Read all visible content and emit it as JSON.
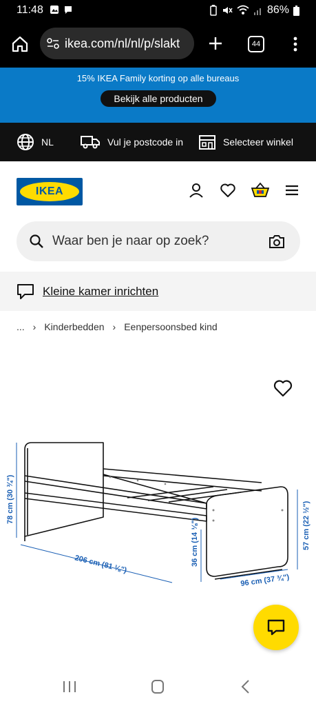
{
  "status": {
    "time": "11:48",
    "battery": "86%"
  },
  "browser": {
    "url": "ikea.com/nl/nl/p/slakt",
    "tab_count": "44"
  },
  "promo": {
    "text": "15% IKEA Family korting op alle bureaus",
    "button": "Bekijk alle producten"
  },
  "utility": {
    "language": "NL",
    "postcode": "Vul je postcode in",
    "store": "Selecteer winkel"
  },
  "header": {
    "logo_text": "IKEA"
  },
  "search": {
    "placeholder": "Waar ben je naar op zoek?"
  },
  "room": {
    "link": "Kleine kamer inrichten"
  },
  "breadcrumb": {
    "ellipsis": "...",
    "items": [
      "Kinderbedden",
      "Eenpersoonsbed kind"
    ]
  },
  "product_image": {
    "dimensions": {
      "height_total": "78 cm (30 ¾\")",
      "length": "206 cm (81 ⅛\")",
      "bed_height": "36 cm (14 ⅛\")",
      "width": "96 cm (37 ¾\")",
      "foot_height": "57 cm (22 ½\")"
    }
  },
  "colors": {
    "ikea_blue": "#0058a3",
    "ikea_yellow": "#ffdb00",
    "promo_blue": "#0a7ac7",
    "dimension_blue": "#1a5fb4"
  }
}
